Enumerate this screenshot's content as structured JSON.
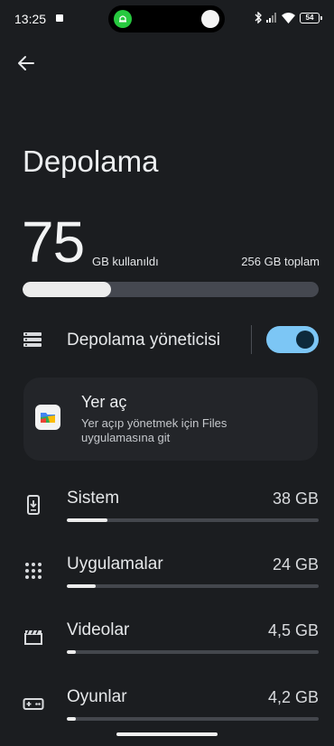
{
  "status_bar": {
    "time": "13:25",
    "battery_level": "54",
    "icons": [
      "notification-square-icon",
      "android-app-icon",
      "bluetooth-icon",
      "signal-icon",
      "wifi-icon",
      "battery-icon"
    ]
  },
  "header": {
    "back_icon": "arrow-left-icon",
    "title": "Depolama"
  },
  "summary": {
    "used_value": "75",
    "used_label": "GB kullanıldı",
    "total_label": "256 GB toplam",
    "used_fraction": 0.3
  },
  "storage_manager": {
    "icon": "storage-list-icon",
    "label": "Depolama yöneticisi",
    "enabled": true
  },
  "free_up_card": {
    "icon": "files-app-icon",
    "title": "Yer aç",
    "description": "Yer açıp yönetmek için Files uygulamasına git"
  },
  "categories": [
    {
      "name": "Sistem",
      "size": "38 GB",
      "icon": "system-phone-icon",
      "fraction": 0.16
    },
    {
      "name": "Uygulamalar",
      "size": "24 GB",
      "icon": "apps-grid-icon",
      "fraction": 0.115
    },
    {
      "name": "Videolar",
      "size": "4,5 GB",
      "icon": "video-clapper-icon",
      "fraction": 0.035
    },
    {
      "name": "Oyunlar",
      "size": "4,2 GB",
      "icon": "gamepad-icon",
      "fraction": 0.035
    }
  ],
  "colors": {
    "background": "#1b1d20",
    "accent_toggle": "#7cc6f5",
    "bar_fill": "#ececec",
    "bar_track": "#454850"
  }
}
